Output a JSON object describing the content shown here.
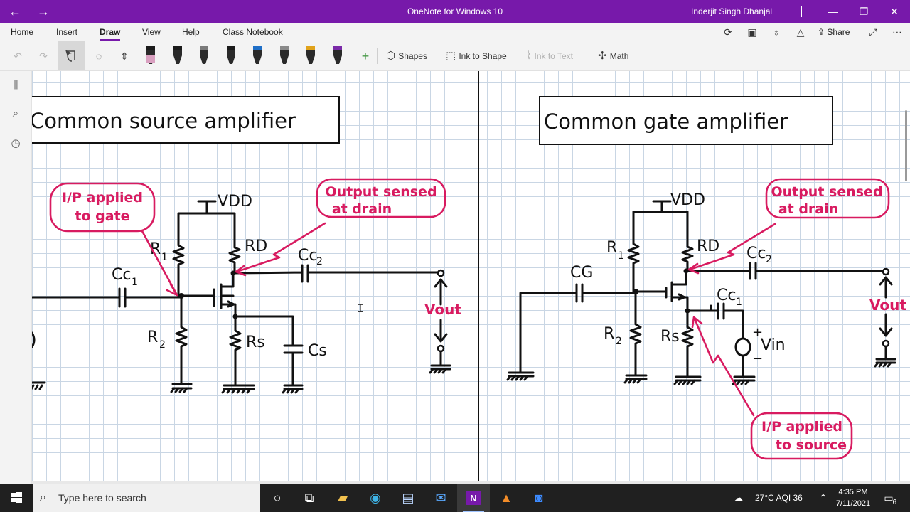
{
  "window": {
    "title": "OneNote for Windows 10",
    "user": "Inderjit Singh Dhanjal",
    "back_glyph": "←",
    "forward_glyph": "→",
    "minimize_glyph": "—",
    "maximize_glyph": "❐",
    "close_glyph": "✕",
    "accent": "#7719aa"
  },
  "ribbon": {
    "tabs": [
      "Home",
      "Insert",
      "Draw",
      "View",
      "Help",
      "Class Notebook"
    ],
    "active_tab": "Draw",
    "share_label": "Share"
  },
  "toolbar": {
    "shapes_label": "Shapes",
    "ink_to_shape_label": "Ink to Shape",
    "ink_to_text_label": "Ink to Text",
    "math_label": "Math",
    "pen_colors": [
      "#1a1a1a",
      "#1a1a1a",
      "#7a7a7a",
      "#1a1a1a",
      "#1f6fc7",
      "#8a8a8a",
      "#e0a21a",
      "#7a2aa8"
    ]
  },
  "canvas": {
    "left_title": "Common source amplifier",
    "right_title": "Common gate amplifier",
    "left": {
      "note_input": [
        "I/P applied",
        "to gate"
      ],
      "note_output": [
        "Output sensed",
        "at drain"
      ],
      "vdd": "VDD",
      "r1": "R",
      "r1_sub": "1",
      "rd": "RD",
      "cc2": "Cc",
      "cc2_sub": "2",
      "cc1": "Cc",
      "cc1_sub": "1",
      "r2": "R",
      "r2_sub": "2",
      "rs": "Rs",
      "cs": "Cs",
      "vout": "Vout"
    },
    "right": {
      "note_output": [
        "Output sensed",
        "at drain"
      ],
      "note_input": [
        "I/P applied",
        "to source"
      ],
      "vdd": "VDD",
      "r1": "R",
      "r1_sub": "1",
      "rd": "RD",
      "cc2": "Cc",
      "cc2_sub": "2",
      "cg": "CG",
      "cc1": "Cc",
      "cc1_sub": "1",
      "r2": "R",
      "r2_sub": "2",
      "rs": "Rs",
      "vin": "Vin",
      "vout": "Vout"
    }
  },
  "taskbar": {
    "search_placeholder": "Type here to search",
    "weather": "27°C AQI 36",
    "time": "4:35 PM",
    "date": "7/11/2021",
    "notification_count": "6"
  }
}
